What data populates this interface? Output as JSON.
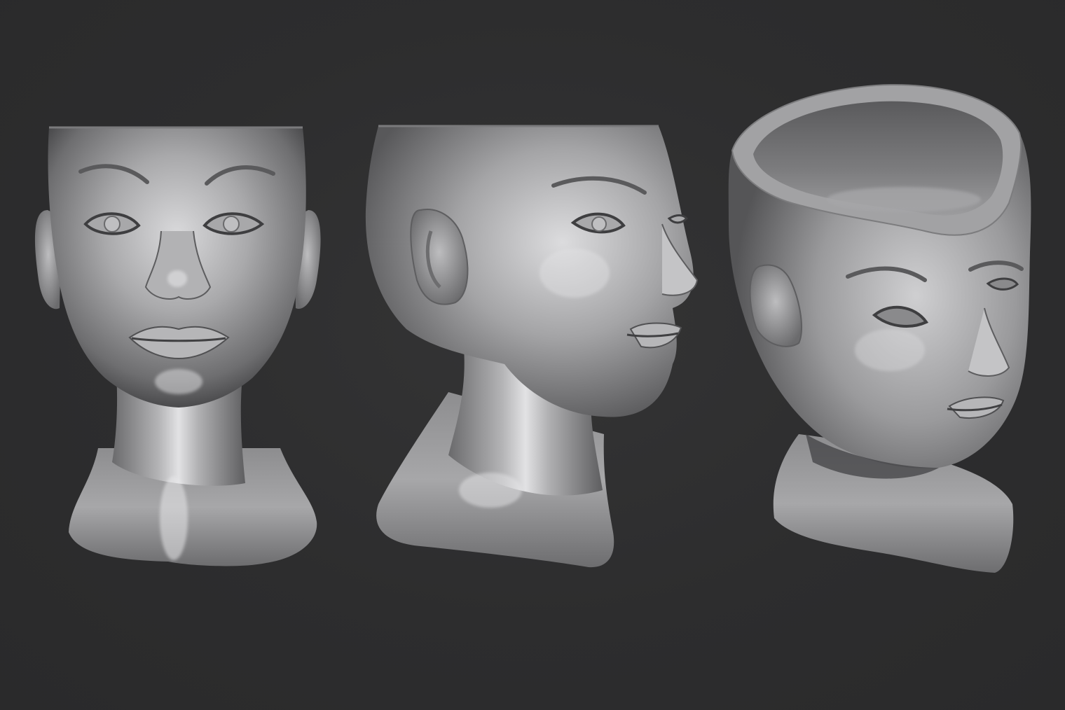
{
  "scene": {
    "background_color": "#2d2d2e",
    "clay_color": "#9a9a9c",
    "highlight_color": "#e6e6e8",
    "shadow_color": "#3a3a3c",
    "views": [
      {
        "id": "front",
        "description_icon": "head-front-view"
      },
      {
        "id": "side",
        "description_icon": "head-three-quarter-view"
      },
      {
        "id": "top",
        "description_icon": "head-open-top-view"
      }
    ]
  }
}
